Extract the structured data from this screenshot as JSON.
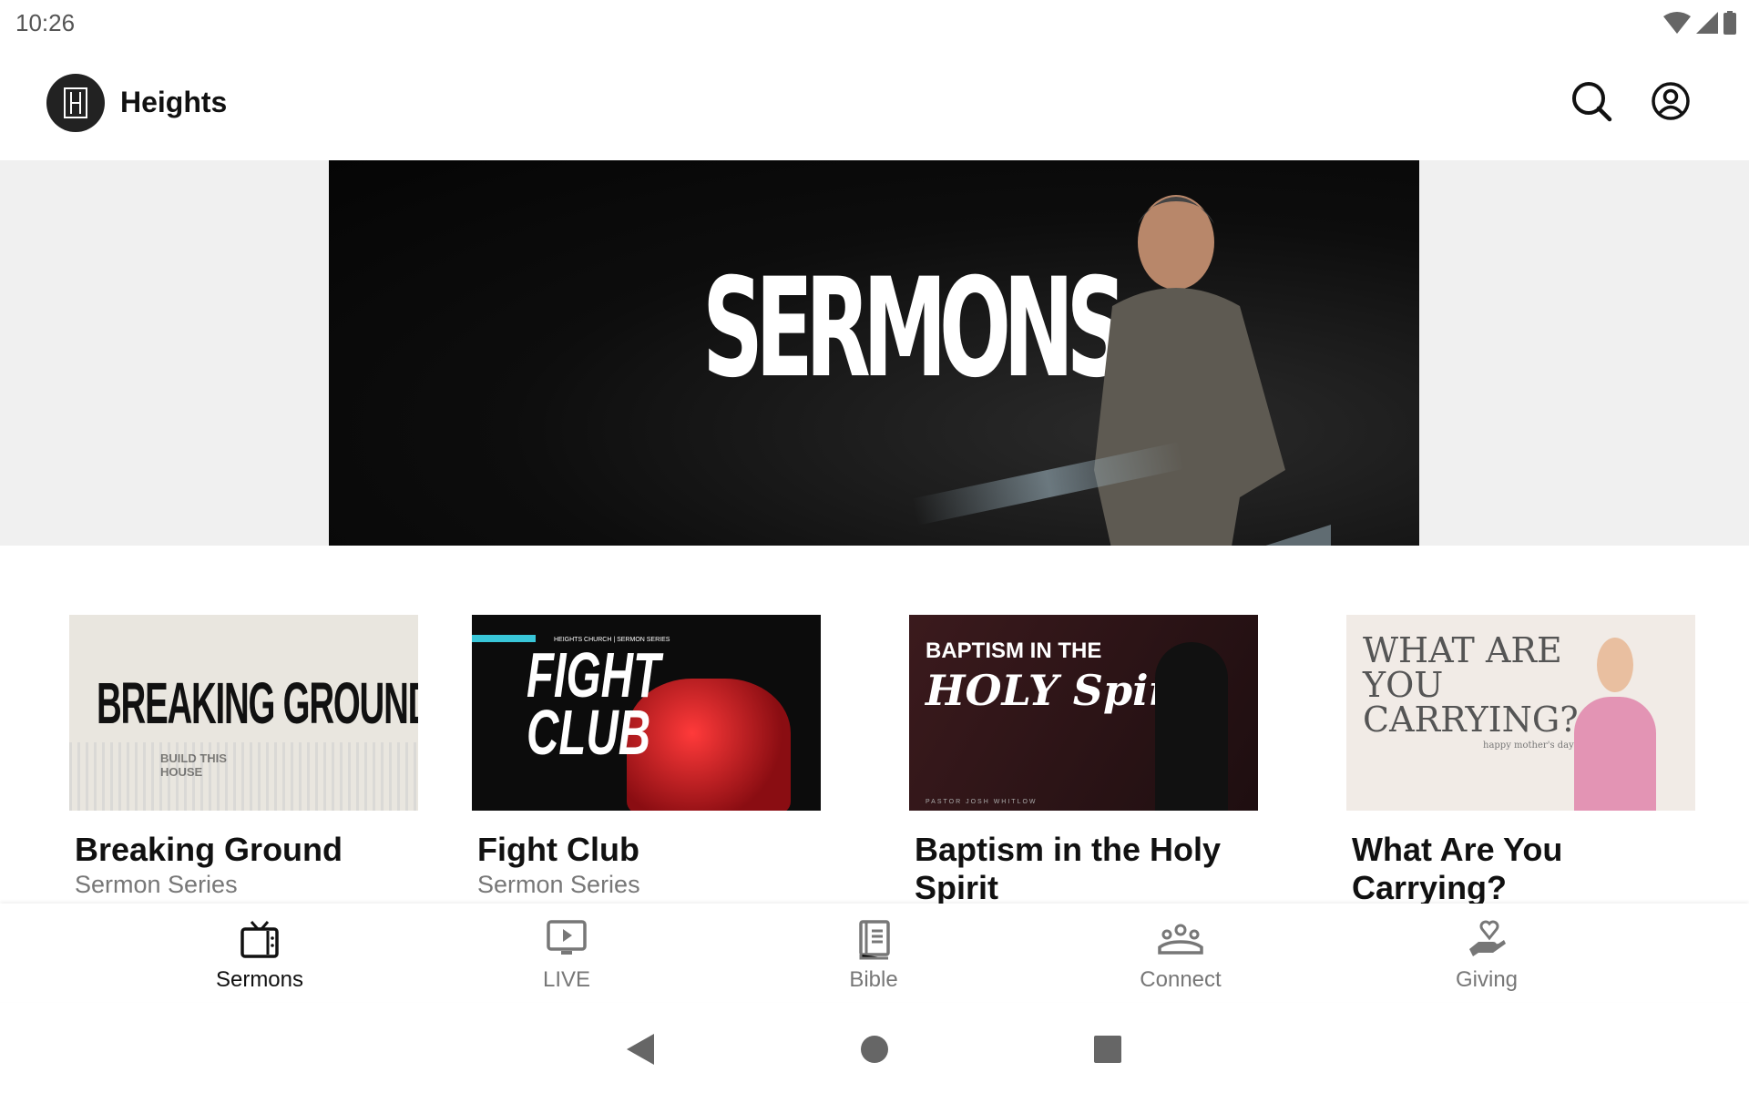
{
  "status_bar": {
    "time": "10:26",
    "icons": [
      "wifi-icon",
      "signal-icon",
      "battery-icon"
    ]
  },
  "app_bar": {
    "title": "Heights",
    "logo_letter": "H",
    "actions": [
      "search-icon",
      "account-icon"
    ]
  },
  "hero": {
    "text": "SERMONS"
  },
  "cards": [
    {
      "title": "Breaking Ground",
      "subtitle": "Sermon Series",
      "thumb_text": "BREAKING GROUND",
      "thumb_sub": "BUILD THIS HOUSE"
    },
    {
      "title": "Fight Club",
      "subtitle": "Sermon Series",
      "thumb_text": "FIGHT CLUB",
      "thumb_sub": "HEIGHTS CHURCH | SERMON SERIES"
    },
    {
      "title": "Baptism in the Holy Spirit",
      "subtitle": "",
      "thumb_text": "BAPTISM IN THE",
      "thumb_text2": "HOLY Spirit",
      "thumb_sub": "PASTOR JOSH WHITLOW"
    },
    {
      "title": "What Are You Carrying?",
      "subtitle": "",
      "thumb_text": "WHAT ARE YOU CARRYING?",
      "thumb_sub": "happy mother's day"
    }
  ],
  "bottom_nav": [
    {
      "label": "Sermons",
      "icon": "tv-icon",
      "active": true
    },
    {
      "label": "LIVE",
      "icon": "live-video-icon",
      "active": false
    },
    {
      "label": "Bible",
      "icon": "book-icon",
      "active": false
    },
    {
      "label": "Connect",
      "icon": "group-icon",
      "active": false
    },
    {
      "label": "Giving",
      "icon": "giving-hand-icon",
      "active": false
    }
  ],
  "colors": {
    "accent": "#111111",
    "inactive": "#777777",
    "banner_bg": "#f0f0f0"
  }
}
